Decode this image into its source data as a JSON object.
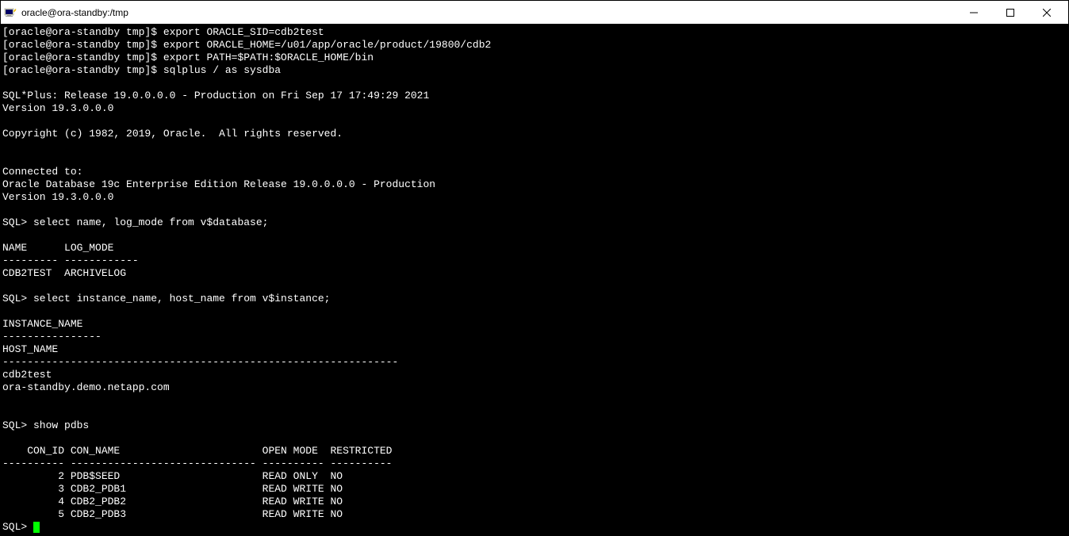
{
  "window": {
    "title": "oracle@ora-standby:/tmp"
  },
  "terminal": {
    "lines": [
      "[oracle@ora-standby tmp]$ export ORACLE_SID=cdb2test",
      "[oracle@ora-standby tmp]$ export ORACLE_HOME=/u01/app/oracle/product/19800/cdb2",
      "[oracle@ora-standby tmp]$ export PATH=$PATH:$ORACLE_HOME/bin",
      "[oracle@ora-standby tmp]$ sqlplus / as sysdba",
      "",
      "SQL*Plus: Release 19.0.0.0.0 - Production on Fri Sep 17 17:49:29 2021",
      "Version 19.3.0.0.0",
      "",
      "Copyright (c) 1982, 2019, Oracle.  All rights reserved.",
      "",
      "",
      "Connected to:",
      "Oracle Database 19c Enterprise Edition Release 19.0.0.0.0 - Production",
      "Version 19.3.0.0.0",
      "",
      "SQL> select name, log_mode from v$database;",
      "",
      "NAME      LOG_MODE",
      "--------- ------------",
      "CDB2TEST  ARCHIVELOG",
      "",
      "SQL> select instance_name, host_name from v$instance;",
      "",
      "INSTANCE_NAME",
      "----------------",
      "HOST_NAME",
      "----------------------------------------------------------------",
      "cdb2test",
      "ora-standby.demo.netapp.com",
      "",
      "",
      "SQL> show pdbs",
      "",
      "    CON_ID CON_NAME                       OPEN MODE  RESTRICTED",
      "---------- ------------------------------ ---------- ----------",
      "         2 PDB$SEED                       READ ONLY  NO",
      "         3 CDB2_PDB1                      READ WRITE NO",
      "         4 CDB2_PDB2                      READ WRITE NO",
      "         5 CDB2_PDB3                      READ WRITE NO"
    ],
    "prompt": "SQL> "
  }
}
